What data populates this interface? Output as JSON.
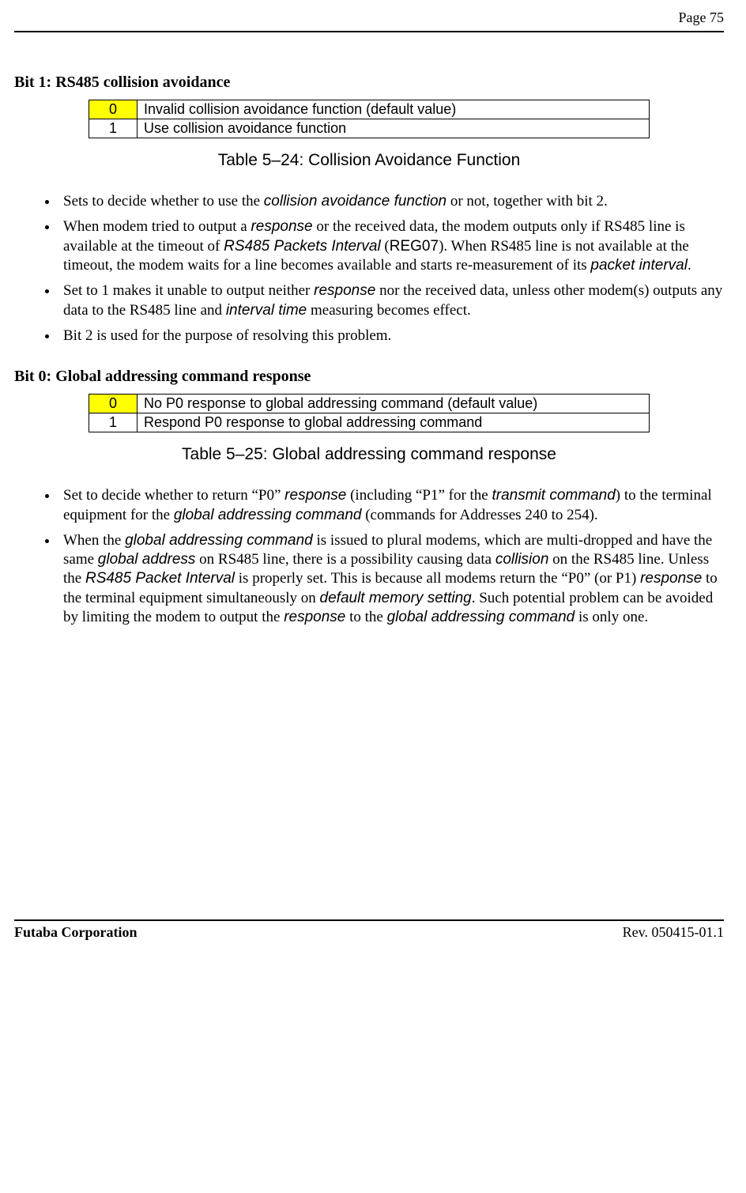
{
  "header": {
    "page_label": "Page  75"
  },
  "bit1": {
    "heading": "Bit 1:  RS485 collision avoidance",
    "rows": [
      {
        "val": "0",
        "desc": "Invalid collision avoidance function (default value)"
      },
      {
        "val": "1",
        "desc": "Use  collision avoidance function"
      }
    ],
    "caption": "Table 5–24:  Collision Avoidance Function",
    "bullets": {
      "b1a": "Sets to decide whether to use the ",
      "b1b": "collision avoidance function",
      "b1c": " or not, together with bit 2.",
      "b2a": "When modem tried to output a ",
      "b2b": "response",
      "b2c": " or the received data, the modem outputs only if RS485 line is available at the timeout of ",
      "b2d": "RS485 Packets Interval",
      "b2e": " (",
      "b2f": "REG07",
      "b2g": ").  When RS485 line is not available at the timeout, the modem waits for a line becomes available and starts re-measurement of its ",
      "b2h": "packet interval",
      "b2i": ".",
      "b3a": "Set to 1 makes it unable to output neither ",
      "b3b": "response",
      "b3c": " nor the received data, unless other modem(s) outputs any data to the RS485 line and ",
      "b3d": "interval time",
      "b3e": " measuring becomes effect.",
      "b4": "Bit 2 is used for the purpose of resolving this problem."
    }
  },
  "bit0": {
    "heading": "Bit 0:  Global addressing command response",
    "rows": [
      {
        "val": "0",
        "desc": "No P0 response to global addressing command (default value)"
      },
      {
        "val": "1",
        "desc": "Respond P0 response to global addressing command"
      }
    ],
    "caption": "Table 5–25:  Global addressing command response",
    "bullets": {
      "b1a": "Set to decide whether to return “P0” ",
      "b1b": "response",
      "b1c": " (including “P1” for the ",
      "b1d": "transmit command",
      "b1e": ") to the terminal equipment for the ",
      "b1f": "global addressing command",
      "b1g": " (commands for Addresses 240 to 254).",
      "b2a": "When the ",
      "b2b": "global addressing command",
      "b2c": " is issued to plural modems, which are multi-dropped and have the same ",
      "b2d": "global address",
      "b2e": " on RS485 line, there is a possibility causing data ",
      "b2f": "collision",
      "b2g": " on the RS485 line. Unless the ",
      "b2h": "RS485 Packet Interval",
      "b2i": " is properly set. This is because all modems return the “P0” (or P1) ",
      "b2j": "response",
      "b2k": " to the terminal equipment simultaneously on ",
      "b2l": "default memory setting",
      "b2m": ". Such potential problem can be avoided by limiting the modem to output the ",
      "b2n": "response",
      "b2o": " to the ",
      "b2p": "global addressing command",
      "b2q": " is only one."
    }
  },
  "footer": {
    "left": "Futaba Corporation",
    "right": "Rev. 050415-01.1"
  }
}
